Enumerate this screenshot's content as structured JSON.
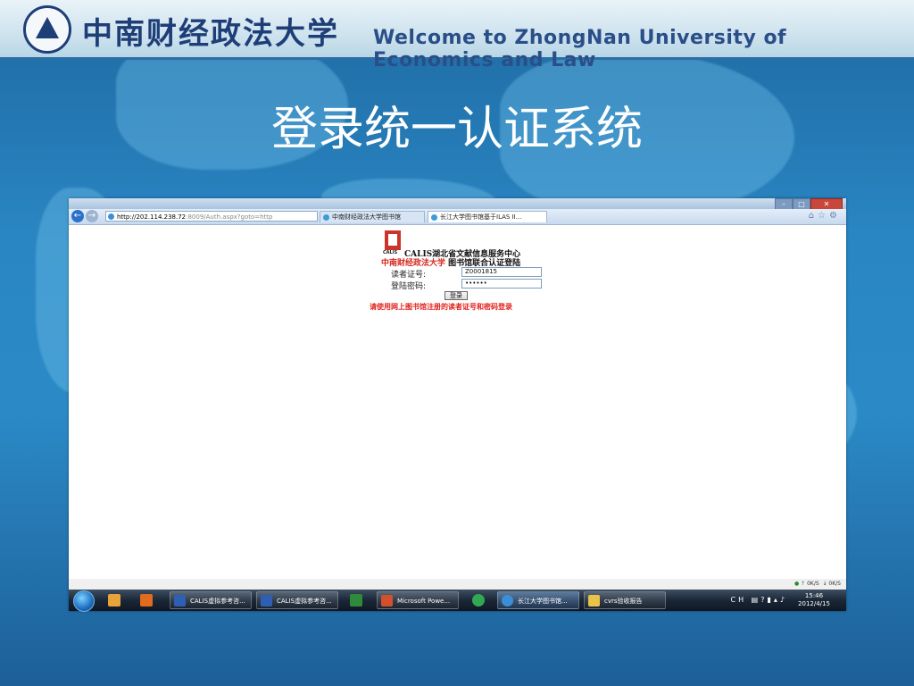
{
  "header": {
    "university_name": "中南财经政法大学",
    "welcome_text": "Welcome to ZhongNan University of Economics and Law"
  },
  "slide": {
    "title": "登录统一认证系统"
  },
  "browser": {
    "address": {
      "host": "http://202.114.238.72",
      "rest": ":8009/Auth.aspx?goto=http"
    },
    "tabs": [
      {
        "label": "中南财经政法大学图书馆"
      },
      {
        "label": "长江大学图书馆基于ILAS II..."
      }
    ]
  },
  "login_page": {
    "calis_logo_text": "CALIS",
    "line1": "CALIS湖北省文献信息服务中心",
    "line2_red": "中南财经政法大学",
    "line2_rest": " 图书馆联合认证登陆",
    "reader_id_label": "读者证号:",
    "reader_id_value": "Z0001815",
    "password_label": "登陆密码:",
    "password_value": "••••••",
    "login_button": "登录",
    "notice": "请使用网上图书馆注册的读者证号和密码登录"
  },
  "statusbar": {
    "upload_speed": "0K/S",
    "download_speed": "0K/S"
  },
  "taskbar": {
    "items": [
      {
        "label": "CALIS虚拟参考咨..."
      },
      {
        "label": "CALIS虚拟参考咨..."
      },
      {
        "label": "Microsoft Powe..."
      },
      {
        "label": "长江大学图书馆..."
      },
      {
        "label": "cvrs验收报告"
      }
    ],
    "clock_time": "15:46",
    "clock_date": "2012/4/15",
    "lang": "CH"
  },
  "colors": {
    "slide_background": "#2a86c2",
    "title_color": "#ffffff",
    "notice_red": "#e0211c"
  }
}
